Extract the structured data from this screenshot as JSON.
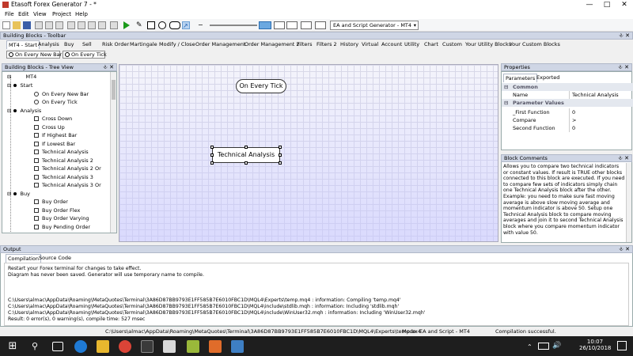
{
  "window": {
    "title": "Etasoft Forex Generator 7 - *"
  },
  "menu": [
    "File",
    "Edit",
    "View",
    "Project",
    "Help"
  ],
  "toolbar": {
    "generator_select": "EA and Script Generator - MT4"
  },
  "blocks_toolbar": {
    "title": "Building Blocks - Toolbar",
    "tabs": [
      "MT4 - Start",
      "Analysis",
      "Buy",
      "Sell",
      "Risk Order",
      "Martingale",
      "Modify / Close",
      "Order Management",
      "Order Management 2",
      "Filters",
      "Filters 2",
      "History",
      "Virtual",
      "Account",
      "Utility",
      "Chart",
      "Custom",
      "Your Utility Blocks",
      "Your Custom Blocks"
    ],
    "events": [
      "On Every New Bar",
      "On Every Tick"
    ]
  },
  "tree": {
    "title": "Building Blocks - Tree View",
    "root": "MT4",
    "groups": [
      {
        "label": "Start",
        "items": [
          "On Every New Bar",
          "On Every Tick"
        ]
      },
      {
        "label": "Analysis",
        "items": [
          "Cross Down",
          "Cross Up",
          "If Highest Bar",
          "If Lowest Bar",
          "Technical Analysis",
          "Technical Analysis 2",
          "Technical Analysis 2 Or",
          "Technical Analysis 3",
          "Technical Analysis 3 Or"
        ]
      },
      {
        "label": "Buy",
        "items": [
          "Buy Order",
          "Buy Order Flex",
          "Buy Order Varying",
          "Buy Pending Order"
        ]
      }
    ]
  },
  "canvas": {
    "start_node": "On Every Tick",
    "selected_node": "Technical Analysis"
  },
  "properties": {
    "title": "Properties",
    "tabs": [
      "Parameters",
      "Exported"
    ],
    "common_label": "Common",
    "name_key": "Name",
    "name_value": "Technical Analysis",
    "params_label": "Parameter Values",
    "params": [
      {
        "key": "_First Function",
        "value": "0"
      },
      {
        "key": "Compare",
        "value": ">"
      },
      {
        "key": "Second Function",
        "value": "0"
      }
    ]
  },
  "comments": {
    "title": "Block Comments",
    "text": "Allows you to compare two technical indicators or constant values. If result is TRUE other blocks connected to this block are executed. If you need to compare few sets of indicators simply chain one Technical Analysis block after the other. Example: you need to make sure fast moving average is above slow moving average and momentum indicator is above 50. Setup one Technical Analysis block to compare moving averages and join it to second Technical Analysis block where you compare momentum indicator with value 50."
  },
  "output": {
    "title": "Output",
    "tabs": [
      "Compilation",
      "Source Code"
    ],
    "lines": [
      "Restart your Forex terminal for changes to take effect.",
      "Diagram has never been saved. Generator will use temporary name to compile.",
      "",
      "",
      "C:\\Users\\almac\\AppData\\Roaming\\MetaQuotes\\Terminal\\3A86D87BB9793E1FF585B7E6010FBC1D\\MQL4\\Experts\\temp.mq4 : information: Compiling 'temp.mq4'",
      "C:\\Users\\almac\\AppData\\Roaming\\MetaQuotes\\Terminal\\3A86D87BB9793E1FF585B7E6010FBC1D\\MQL4\\include\\stdlib.mqh : information: Including 'stdlib.mqh'",
      "C:\\Users\\almac\\AppData\\Roaming\\MetaQuotes\\Terminal\\3A86D87BB9793E1FF585B7E6010FBC1D\\MQL4\\include\\WinUser32.mqh : information: Including 'WinUser32.mqh'",
      "Result: 0 error(s), 0 warning(s), compile time: 527 msec"
    ]
  },
  "status": {
    "path": "C:\\Users\\almac\\AppData\\Roaming\\MetaQuotes\\Terminal\\3A86D87BB9793E1FF585B7E6010FBC1D\\MQL4\\Experts\\temp.ex4",
    "mode": "Mode: EA and Script - MT4",
    "result": "Compilation successful."
  },
  "taskbar": {
    "time": "10:07",
    "date": "26/10/2018"
  },
  "colors": {
    "panel_header": "#cfd6e5",
    "canvas_gradient": "#c4c4ff",
    "taskbar": "#1e1e1e"
  }
}
